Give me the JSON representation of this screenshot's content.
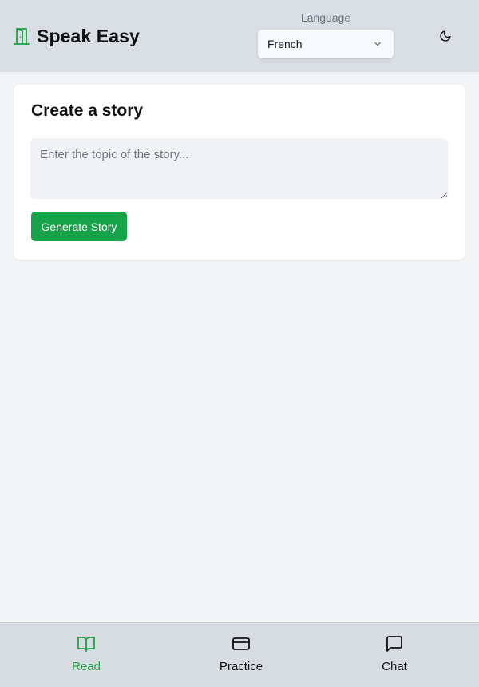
{
  "header": {
    "title": "Speak Easy",
    "brand_icon": "door-icon",
    "language_label": "Language",
    "language_selected": "French",
    "theme_icon": "moon-icon"
  },
  "story": {
    "title": "Create a story",
    "topic_placeholder": "Enter the topic of the story...",
    "topic_value": "",
    "generate_label": "Generate Story"
  },
  "nav": {
    "items": [
      {
        "label": "Read",
        "icon": "book-open-icon",
        "active": true
      },
      {
        "label": "Practice",
        "icon": "card-icon",
        "active": false
      },
      {
        "label": "Chat",
        "icon": "message-square-icon",
        "active": false
      }
    ]
  },
  "colors": {
    "accent": "#16a34a",
    "active_nav": "#22a447",
    "header_bg": "#d9dee4",
    "page_bg": "#f3f4f6"
  }
}
